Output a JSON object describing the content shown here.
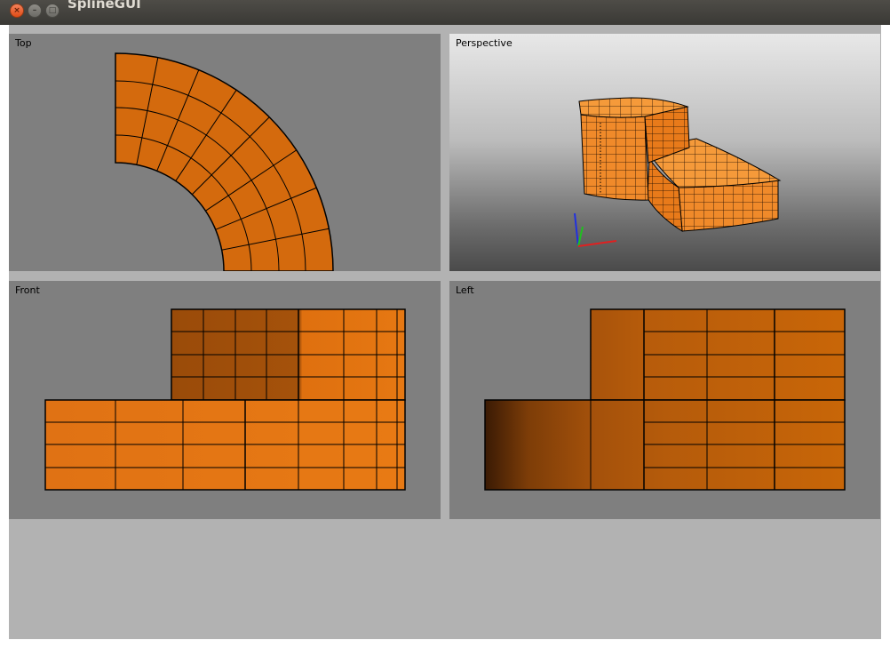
{
  "window": {
    "title": "SplineGUI",
    "buttons": {
      "close_icon": "×",
      "minimize_icon": "–",
      "maximize_icon": "□"
    }
  },
  "viewports": {
    "top": {
      "label": "Top"
    },
    "perspective": {
      "label": "Perspective"
    },
    "front": {
      "label": "Front"
    },
    "left": {
      "label": "Left"
    }
  },
  "colors": {
    "mesh_fill": "#d46a0d",
    "mesh_bright": "#e8770f",
    "mesh_shadow": "#8a4a12",
    "edge": "#000000",
    "viewport_bg": "#7f7f7f",
    "panel_bg": "#b2b2b2",
    "axis_x": "#e02020",
    "axis_y": "#20c020",
    "axis_z": "#2030e0"
  }
}
